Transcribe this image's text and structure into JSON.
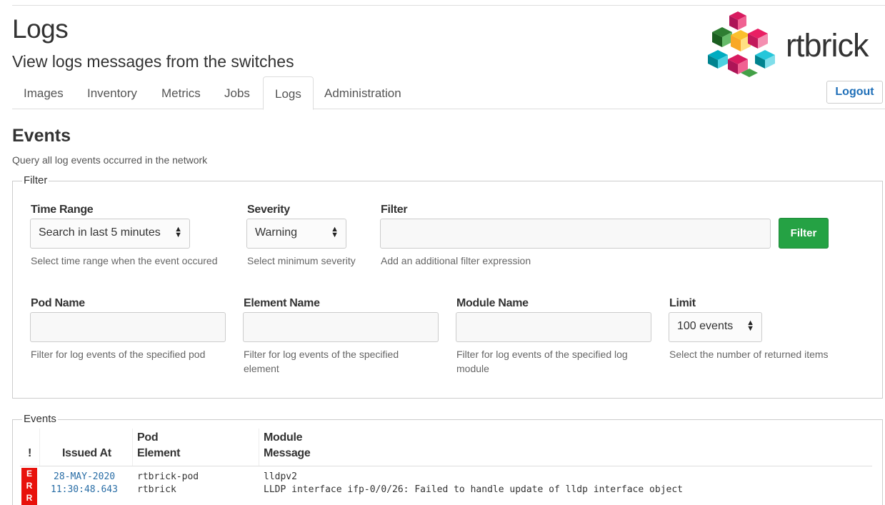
{
  "header": {
    "title": "Logs",
    "subtitle": "View logs messages from the switches",
    "logo_text": "rtbrick"
  },
  "tabs": [
    {
      "label": "Images"
    },
    {
      "label": "Inventory"
    },
    {
      "label": "Metrics"
    },
    {
      "label": "Jobs"
    },
    {
      "label": "Logs",
      "active": true
    },
    {
      "label": "Administration"
    }
  ],
  "logout_label": "Logout",
  "events_section": {
    "title": "Events",
    "description": "Query all log events occurred in the network"
  },
  "filter_panel": {
    "legend": "Filter",
    "time_range": {
      "label": "Time Range",
      "value": "Search in last 5 minutes",
      "help": "Select time range when the event occured"
    },
    "severity": {
      "label": "Severity",
      "value": "Warning",
      "help": "Select minimum severity"
    },
    "filter_expr": {
      "label": "Filter",
      "value": "",
      "help": "Add an additional filter expression"
    },
    "filter_button": "Filter",
    "pod_name": {
      "label": "Pod Name",
      "value": "",
      "help": "Filter for log events of the specified pod"
    },
    "element_name": {
      "label": "Element Name",
      "value": "",
      "help_line1": "Filter for log events of the specified",
      "help_line2": "element"
    },
    "module_name": {
      "label": "Module Name",
      "value": "",
      "help_line1": "Filter for log events of the specified log",
      "help_line2": "module"
    },
    "limit": {
      "label": "Limit",
      "value": "100 events",
      "help": "Select the number of returned items"
    }
  },
  "events_table": {
    "legend": "Events",
    "headers": {
      "severity": "!",
      "issued_at": "Issued At",
      "pod": "Pod",
      "element": "Element",
      "module": "Module",
      "message": "Message"
    },
    "rows": [
      {
        "severity": "ERR",
        "severity_color": "#e8120c",
        "date": "28-MAY-2020",
        "time": "11:30:48.643",
        "pod": "rtbrick-pod",
        "element": "rtbrick",
        "module": "lldpv2",
        "message": "LLDP interface ifp-0/0/26: Failed to handle update of lldp interface object"
      }
    ]
  },
  "colors": {
    "accent_link": "#1f6fb8",
    "filter_button": "#25a244",
    "error_badge": "#e8120c"
  }
}
